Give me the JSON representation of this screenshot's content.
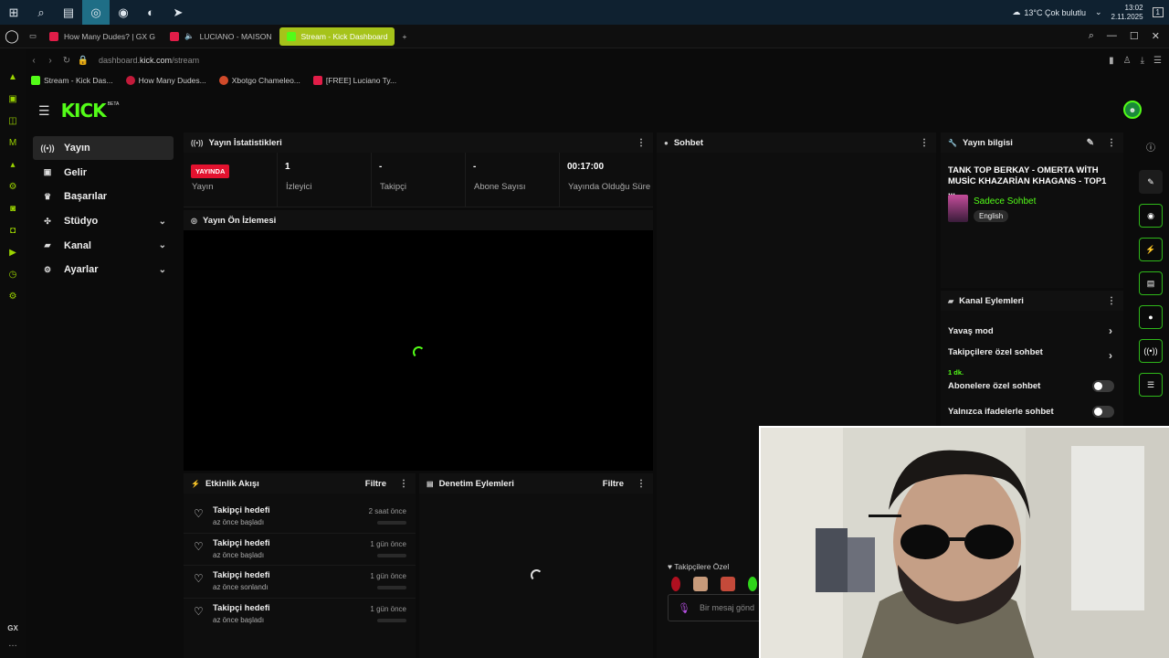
{
  "taskbar": {
    "weather": "13°C  Çok bulutlu",
    "time": "13:02",
    "date": "2.11.2025",
    "notif_count": "1"
  },
  "browser": {
    "tabs": [
      {
        "label": "How Many Dudes? | GX G",
        "color": "#e11d48"
      },
      {
        "label": "LUCIANO - MAISON",
        "color": "#e11d48"
      },
      {
        "label": "Stream - Kick Dashboard",
        "color": "#53fc18"
      }
    ],
    "url_prefix": "dashboard.",
    "url_domain": "kick.com",
    "url_path": "/stream",
    "bookmarks": [
      "Stream - Kick Das...",
      "How Many Dudes...",
      "Xbotgo Chameleo...",
      "[FREE] Luciano Ty..."
    ]
  },
  "kick": {
    "logo": "KICK",
    "beta": "BETA",
    "accent": "#53fc18",
    "nav": [
      {
        "label": "Yayın",
        "icon": "broadcast-icon"
      },
      {
        "label": "Gelir",
        "icon": "revenue-icon"
      },
      {
        "label": "Başarılar",
        "icon": "trophy-icon"
      },
      {
        "label": "Stüdyo",
        "icon": "studio-icon"
      },
      {
        "label": "Kanal",
        "icon": "channel-icon"
      },
      {
        "label": "Ayarlar",
        "icon": "gear-icon"
      }
    ]
  },
  "stats": {
    "title": "Yayın İstatistikleri",
    "live_badge": "YAYINDA",
    "live_label": "Yayın",
    "viewers_value": "1",
    "viewers_label": "İzleyici",
    "followers_value": "-",
    "followers_label": "Takipçi",
    "subs_value": "-",
    "subs_label": "Abone Sayısı",
    "uptime_value": "00:17:00",
    "uptime_label": "Yayında Olduğu Süre"
  },
  "preview": {
    "title": "Yayın Ön İzlemesi"
  },
  "activity": {
    "title": "Etkinlik Akışı",
    "filter": "Filtre",
    "items": [
      {
        "title": "Takipçi hedefi",
        "sub": "az önce başladı",
        "time": "2 saat önce"
      },
      {
        "title": "Takipçi hedefi",
        "sub": "az önce başladı",
        "time": "1 gün önce"
      },
      {
        "title": "Takipçi hedefi",
        "sub": "az önce sonlandı",
        "time": "1 gün önce"
      },
      {
        "title": "Takipçi hedefi",
        "sub": "az önce başladı",
        "time": "1 gün önce"
      }
    ]
  },
  "moderation": {
    "title": "Denetim Eylemleri",
    "filter": "Filtre"
  },
  "chat": {
    "title": "Sohbet",
    "followers_only_label": "Takipçilere Özel",
    "input_placeholder": "Bir mesaj gönd"
  },
  "stream_info": {
    "title": "Yayın bilgisi",
    "stream_title": "TANK TOP BERKAY - OMERTA WİTH MUSİC KHAZARİAN KHAGANS - TOP1 ...",
    "category": "Sadece Sohbet",
    "language": "English"
  },
  "channel_actions": {
    "title": "Kanal Eylemleri",
    "slow_mode": "Yavaş mod",
    "followers_chat": "Takipçilere özel sohbet",
    "followers_chat_sub": "1 dk.",
    "subs_chat": "Abonelere özel sohbet",
    "emote_chat": "Yalnızca ifadelerle sohbet"
  }
}
